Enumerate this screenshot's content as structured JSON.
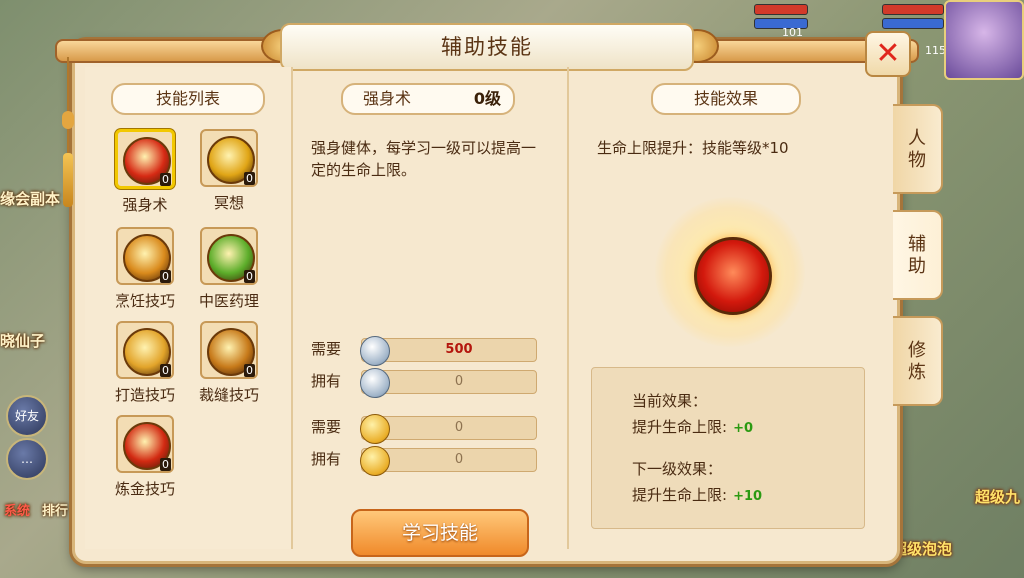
{
  "background": {
    "left_texts": [
      "缘会副本",
      "晓仙子",
      "好友",
      "系统",
      "排行"
    ],
    "right_texts": [
      "超级九",
      "超级泡泡"
    ],
    "status_numbers": [
      "101",
      "115"
    ]
  },
  "panel": {
    "title": "辅助技能",
    "close_label": "✕"
  },
  "skill_list": {
    "header": "技能列表",
    "skills": [
      {
        "name": "强身术",
        "count": "0",
        "color": "#d62a14",
        "selected": true
      },
      {
        "name": "冥想",
        "count": "0",
        "color": "#e0a516",
        "selected": false
      },
      {
        "name": "烹饪技巧",
        "count": "0",
        "color": "#d98a1c",
        "selected": false
      },
      {
        "name": "中医药理",
        "count": "0",
        "color": "#5cad2a",
        "selected": false
      },
      {
        "name": "打造技巧",
        "count": "0",
        "color": "#e2a42a",
        "selected": false
      },
      {
        "name": "裁缝技巧",
        "count": "0",
        "color": "#c77a1a",
        "selected": false
      },
      {
        "name": "炼金技巧",
        "count": "0",
        "color": "#d22a12",
        "selected": false
      }
    ]
  },
  "detail": {
    "skill_name": "强身术",
    "level": "0级",
    "description": "强身健体，每学习一级可以提高一定的生命上限。",
    "resources": [
      {
        "label": "需要",
        "icon": "silver-coin-icon",
        "value": "500",
        "highlight": true
      },
      {
        "label": "拥有",
        "icon": "silver-coin-icon",
        "value": "0",
        "highlight": false
      },
      {
        "label": "需要",
        "icon": "gold-ingot-icon",
        "value": "0",
        "highlight": false
      },
      {
        "label": "拥有",
        "icon": "gold-ingot-icon",
        "value": "0",
        "highlight": false
      }
    ],
    "learn_button": "学习技能"
  },
  "effect": {
    "header": "技能效果",
    "formula": "生命上限提升：技能等级*10",
    "current_title": "当前效果：",
    "current_text": "提升生命上限:",
    "current_value": "+0",
    "next_title": "下一级效果：",
    "next_text": "提升生命上限:",
    "next_value": "+10"
  },
  "side_tabs": [
    {
      "label": "人物",
      "chars": [
        "人",
        "物"
      ],
      "active": false
    },
    {
      "label": "辅助",
      "chars": [
        "辅",
        "助"
      ],
      "active": true
    },
    {
      "label": "修炼",
      "chars": [
        "修",
        "炼"
      ],
      "active": false
    }
  ]
}
